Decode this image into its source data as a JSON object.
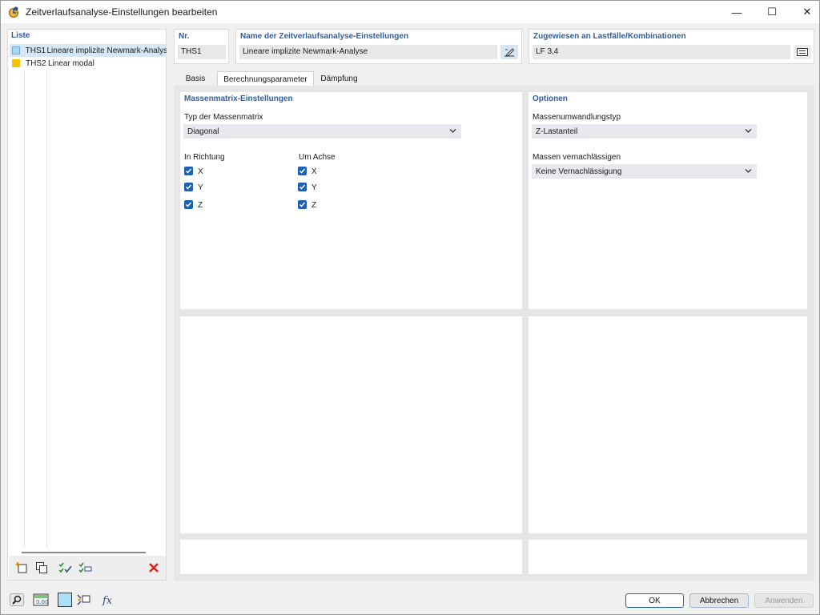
{
  "window": {
    "title": "Zeitverlaufsanalyse-Einstellungen bearbeiten",
    "minimize_glyph": "—",
    "maximize_glyph": "☐",
    "close_glyph": "✕"
  },
  "list": {
    "header": "Liste",
    "items": [
      {
        "code": "THS1",
        "label": "Lineare implizite Newmark-Analyse",
        "color": "#aad7f5",
        "selected": true
      },
      {
        "code": "THS2",
        "label": "Linear modal",
        "color": "#f5c400",
        "selected": false
      }
    ]
  },
  "fields": {
    "nr_label": "Nr.",
    "nr_value": "THS1",
    "name_label": "Name der Zeitverlaufsanalyse-Einstellungen",
    "name_value": "Lineare implizite Newmark-Analyse",
    "assigned_label": "Zugewiesen an Lastfälle/Kombinationen",
    "assigned_value": "LF 3,4"
  },
  "tabs": [
    {
      "label": "Basis",
      "active": false
    },
    {
      "label": "Berechnungsparameter",
      "active": true
    },
    {
      "label": "Dämpfung",
      "active": false
    }
  ],
  "mass_matrix": {
    "title": "Massenmatrix-Einstellungen",
    "type_label": "Typ der Massenmatrix",
    "type_value": "Diagonal",
    "direction_label": "In Richtung",
    "axis_label": "Um Achse",
    "direction_checks": [
      "X",
      "Y",
      "Z"
    ],
    "axis_checks": [
      "X",
      "Y",
      "Z"
    ]
  },
  "options": {
    "title": "Optionen",
    "conversion_label": "Massenumwandlungstyp",
    "conversion_value": "Z-Lastanteil",
    "neglect_label": "Massen vernachlässigen",
    "neglect_value": "Keine Vernachlässigung"
  },
  "buttons": {
    "ok": "OK",
    "cancel": "Abbrechen",
    "apply": "Anwenden"
  },
  "colors": {
    "accent": "#2d5f9e",
    "checkbox": "#1f5fb1",
    "delete": "#e02020"
  }
}
